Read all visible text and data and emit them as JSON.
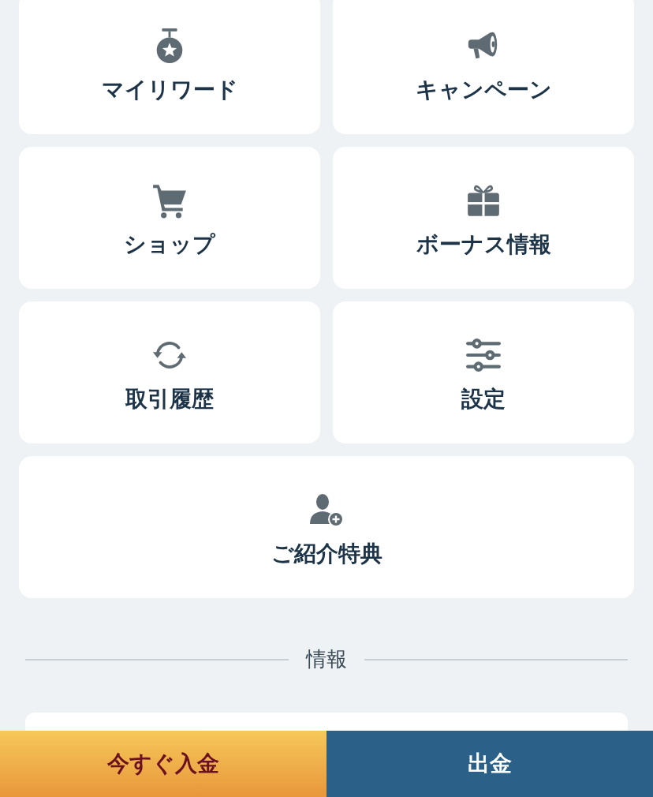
{
  "menu": [
    {
      "label": "マイリワード",
      "kind": "medal"
    },
    {
      "label": "キャンペーン",
      "kind": "megaphone"
    },
    {
      "label": "ショップ",
      "kind": "cart"
    },
    {
      "label": "ボーナス情報",
      "kind": "gift"
    },
    {
      "label": "取引履歴",
      "kind": "sync"
    },
    {
      "label": "設定",
      "kind": "sliders"
    },
    {
      "label": "ご紹介特典",
      "kind": "userplus"
    }
  ],
  "section": {
    "title": "情報"
  },
  "bottom_bar": [
    {
      "label": "今すぐ入金",
      "kind": "primary"
    },
    {
      "label": "出金",
      "kind": "secondary"
    }
  ]
}
